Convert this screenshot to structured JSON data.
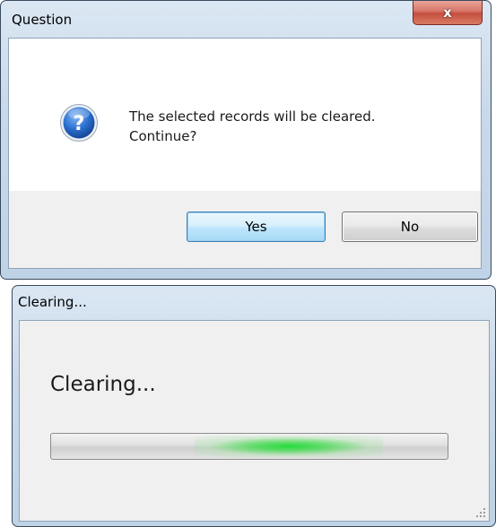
{
  "question_dialog": {
    "title": "Question",
    "close_label": "x",
    "icon": "question-icon",
    "message_lines": [
      "The selected records will be cleared.",
      "Continue?"
    ],
    "yes_label": "Yes",
    "no_label": "No"
  },
  "clearing_dialog": {
    "title": "Clearing...",
    "heading": "Clearing...",
    "progress_style": "marquee",
    "accent_color": "#23dc3c"
  }
}
